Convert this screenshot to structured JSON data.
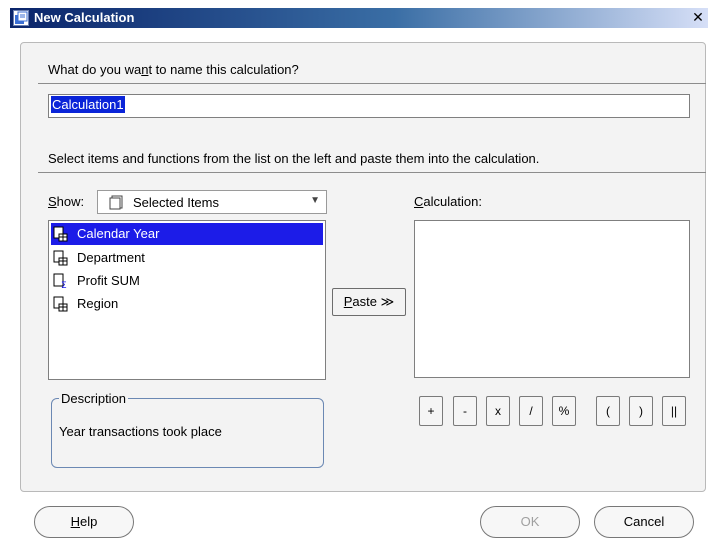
{
  "window": {
    "title": "New Calculation",
    "close_glyph": "✕"
  },
  "name_section": {
    "prompt_before": "What do you wa",
    "prompt_mnemonic": "n",
    "prompt_after": "t to name this calculation?",
    "value": "Calculation1"
  },
  "instructions": "Select items and functions from the list on the left and paste them into the calculation.",
  "show": {
    "label_mnemonic": "S",
    "label_rest": "how:",
    "selected_value": "Selected Items",
    "icon": "document-icon"
  },
  "items": [
    {
      "label": "Calendar Year",
      "icon": "item-icon",
      "selected": true
    },
    {
      "label": "Department",
      "icon": "item-icon",
      "selected": false
    },
    {
      "label": "Profit SUM",
      "icon": "sum-icon",
      "selected": false
    },
    {
      "label": "Region",
      "icon": "item-icon",
      "selected": false
    }
  ],
  "paste": {
    "mnemonic": "P",
    "rest": "aste",
    "glyph": "≫"
  },
  "calculation": {
    "label_mnemonic": "C",
    "label_rest": "alculation:",
    "value": ""
  },
  "operators": [
    "+",
    "-",
    "x",
    "/",
    "%",
    "(",
    ")",
    "||"
  ],
  "description": {
    "legend": "Description",
    "text": "Year transactions took place"
  },
  "buttons": {
    "help_mnemonic": "H",
    "help_rest": "elp",
    "ok": "OK",
    "cancel": "Cancel"
  },
  "colors": {
    "selection": "#1c1ce8",
    "titlebar": "#0a246a",
    "disabled_text": "#a0a0a0"
  }
}
